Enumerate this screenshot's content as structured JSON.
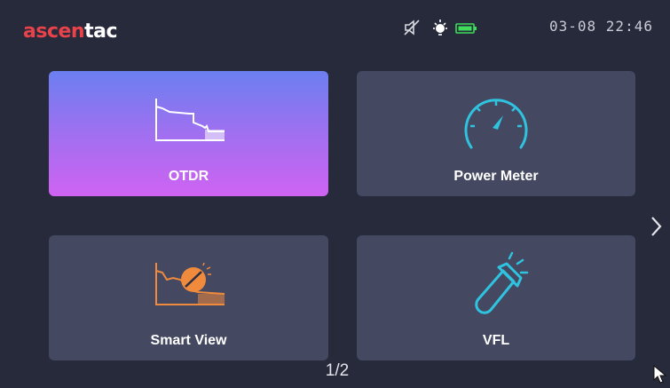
{
  "header": {
    "logo_part1": "ascen",
    "logo_part2": "tac",
    "clock": "03-08 22:46",
    "icons": [
      "speaker-muted-icon",
      "brightness-icon",
      "battery-icon"
    ]
  },
  "tiles": [
    {
      "id": "otdr",
      "label": "OTDR",
      "icon": "otdr-trace-icon"
    },
    {
      "id": "power_meter",
      "label": "Power Meter",
      "icon": "gauge-icon"
    },
    {
      "id": "smart_view",
      "label": "Smart View",
      "icon": "smart-view-icon"
    },
    {
      "id": "vfl",
      "label": "VFL",
      "icon": "flashlight-icon"
    }
  ],
  "pagination": {
    "text": "1/2"
  },
  "colors": {
    "background": "#262a3a",
    "tile": "#444860",
    "accent_red": "#e8424a",
    "cyan": "#2fc3e0",
    "orange": "#f08a3c",
    "battery_green": "#3ddc5a"
  }
}
